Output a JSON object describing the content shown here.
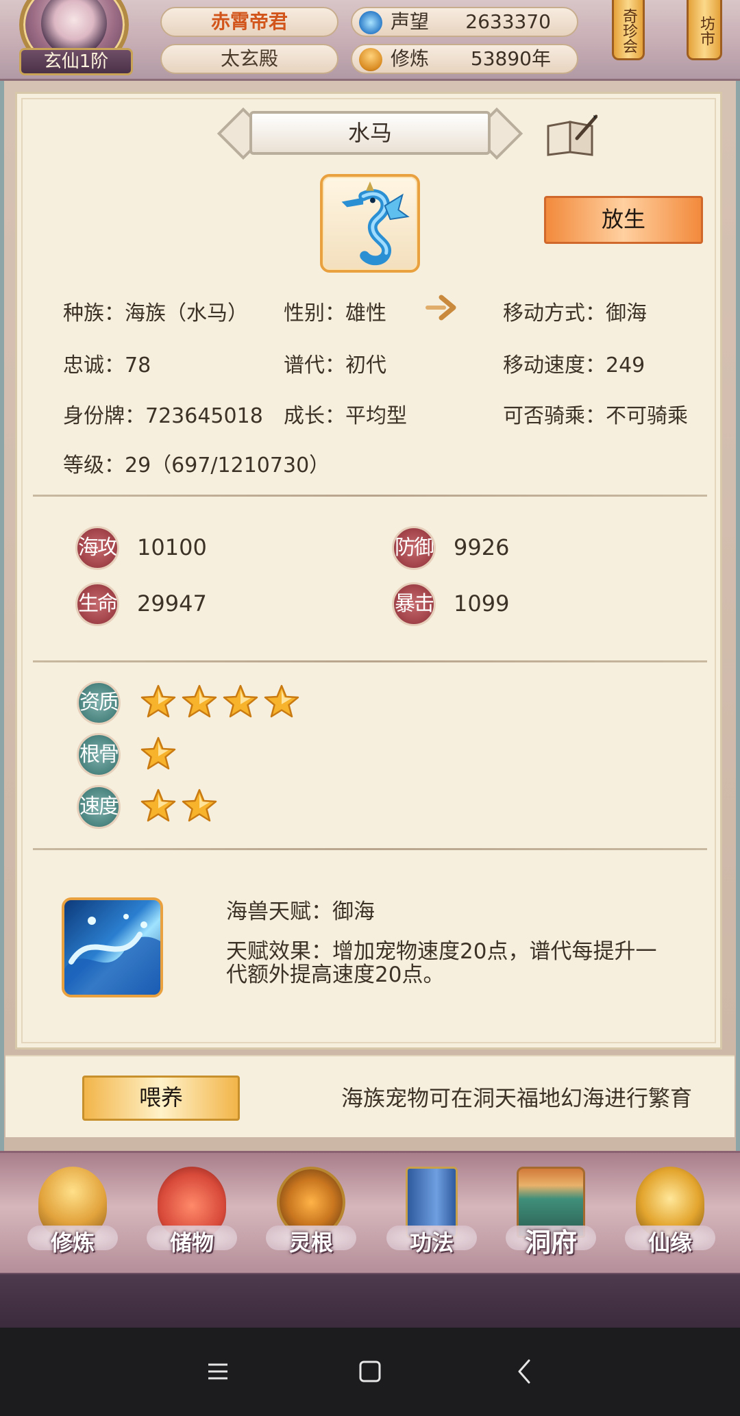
{
  "player": {
    "name": "赤霄帝君",
    "rank": "玄仙1阶",
    "hall": "太玄殿",
    "fame_label": "声望",
    "fame_value": "2633370",
    "cultivation_label": "修炼",
    "cultivation_value": "53890年"
  },
  "top_tags": [
    "奇珍会",
    "坊市"
  ],
  "pet": {
    "name": "水马",
    "release_label": "放生",
    "info_rows": [
      [
        {
          "k": "种族：",
          "v": "海族（水马）"
        },
        {
          "k": "性别：",
          "v": "雄性"
        },
        {
          "k": "移动方式：",
          "v": "御海"
        }
      ],
      [
        {
          "k": "忠诚：",
          "v": "78"
        },
        {
          "k": "谱代：",
          "v": "初代"
        },
        {
          "k": "移动速度：",
          "v": "249"
        }
      ],
      [
        {
          "k": "身份牌：",
          "v": "723645018"
        },
        {
          "k": "成长：",
          "v": "平均型"
        },
        {
          "k": "可否骑乘：",
          "v": "不可骑乘"
        }
      ]
    ],
    "level_label": "等级：",
    "level_value": "29（697/1210730）",
    "stats": [
      {
        "label": "海攻",
        "value": "10100"
      },
      {
        "label": "防御",
        "value": "9926"
      },
      {
        "label": "生命",
        "value": "29947"
      },
      {
        "label": "暴击",
        "value": "1099"
      }
    ],
    "ratings": [
      {
        "label": "资质",
        "stars": 4
      },
      {
        "label": "根骨",
        "stars": 1
      },
      {
        "label": "速度",
        "stars": 2
      }
    ],
    "talent_title": "海兽天赋：御海",
    "talent_desc": "天赋效果：增加宠物速度20点，谱代每提升一代额外提高速度20点。"
  },
  "footer": {
    "feed_label": "喂养",
    "breed_note": "海族宠物可在洞天福地幻海进行繁育"
  },
  "nav": [
    {
      "label": "修炼",
      "icon": "cultivation-icon",
      "color": "#e2a33c"
    },
    {
      "label": "储物",
      "icon": "storage-bag-icon",
      "color": "#d84a3a"
    },
    {
      "label": "灵根",
      "icon": "spirit-root-icon",
      "color": "#c9761f"
    },
    {
      "label": "功法",
      "icon": "skill-book-icon",
      "color": "#3d6fb8"
    },
    {
      "label": "洞府",
      "icon": "cave-mansion-icon",
      "color": "#3f8f7a"
    },
    {
      "label": "仙缘",
      "icon": "immortal-fate-icon",
      "color": "#e3a52e"
    }
  ],
  "colors": {
    "accent_orange": "#e9a03e",
    "name_orange": "#d2561c",
    "badge_red": "#a2434a",
    "badge_teal": "#4d8682",
    "panel_bg": "#f6efde"
  }
}
